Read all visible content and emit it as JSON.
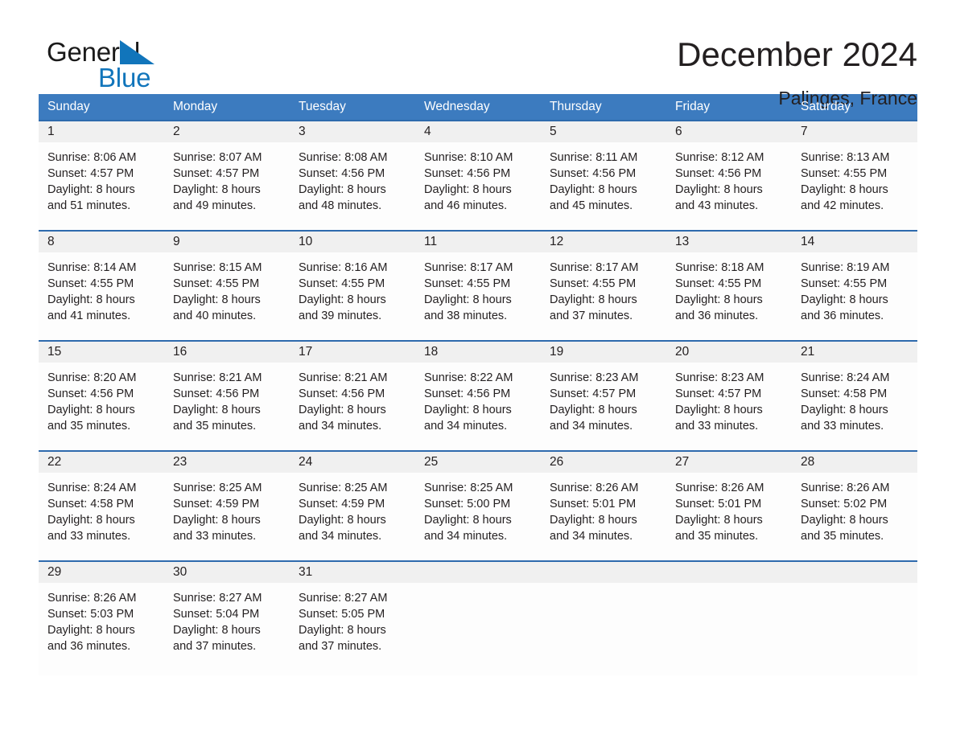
{
  "brand": {
    "word1": "General",
    "word2": "Blue",
    "triangle_color": "#1175bb"
  },
  "header": {
    "title": "December 2024",
    "subtitle": "Palinges, France",
    "accent_color": "#3c7bbf",
    "separator_color": "#2e6aad",
    "date_band_color": "#f0f0f0"
  },
  "weekdays": [
    "Sunday",
    "Monday",
    "Tuesday",
    "Wednesday",
    "Thursday",
    "Friday",
    "Saturday"
  ],
  "weeks": [
    {
      "days": [
        {
          "date": "1",
          "sunrise": "Sunrise: 8:06 AM",
          "sunset": "Sunset: 4:57 PM",
          "daylight_line1": "Daylight: 8 hours",
          "daylight_line2": "and 51 minutes."
        },
        {
          "date": "2",
          "sunrise": "Sunrise: 8:07 AM",
          "sunset": "Sunset: 4:57 PM",
          "daylight_line1": "Daylight: 8 hours",
          "daylight_line2": "and 49 minutes."
        },
        {
          "date": "3",
          "sunrise": "Sunrise: 8:08 AM",
          "sunset": "Sunset: 4:56 PM",
          "daylight_line1": "Daylight: 8 hours",
          "daylight_line2": "and 48 minutes."
        },
        {
          "date": "4",
          "sunrise": "Sunrise: 8:10 AM",
          "sunset": "Sunset: 4:56 PM",
          "daylight_line1": "Daylight: 8 hours",
          "daylight_line2": "and 46 minutes."
        },
        {
          "date": "5",
          "sunrise": "Sunrise: 8:11 AM",
          "sunset": "Sunset: 4:56 PM",
          "daylight_line1": "Daylight: 8 hours",
          "daylight_line2": "and 45 minutes."
        },
        {
          "date": "6",
          "sunrise": "Sunrise: 8:12 AM",
          "sunset": "Sunset: 4:56 PM",
          "daylight_line1": "Daylight: 8 hours",
          "daylight_line2": "and 43 minutes."
        },
        {
          "date": "7",
          "sunrise": "Sunrise: 8:13 AM",
          "sunset": "Sunset: 4:55 PM",
          "daylight_line1": "Daylight: 8 hours",
          "daylight_line2": "and 42 minutes."
        }
      ]
    },
    {
      "days": [
        {
          "date": "8",
          "sunrise": "Sunrise: 8:14 AM",
          "sunset": "Sunset: 4:55 PM",
          "daylight_line1": "Daylight: 8 hours",
          "daylight_line2": "and 41 minutes."
        },
        {
          "date": "9",
          "sunrise": "Sunrise: 8:15 AM",
          "sunset": "Sunset: 4:55 PM",
          "daylight_line1": "Daylight: 8 hours",
          "daylight_line2": "and 40 minutes."
        },
        {
          "date": "10",
          "sunrise": "Sunrise: 8:16 AM",
          "sunset": "Sunset: 4:55 PM",
          "daylight_line1": "Daylight: 8 hours",
          "daylight_line2": "and 39 minutes."
        },
        {
          "date": "11",
          "sunrise": "Sunrise: 8:17 AM",
          "sunset": "Sunset: 4:55 PM",
          "daylight_line1": "Daylight: 8 hours",
          "daylight_line2": "and 38 minutes."
        },
        {
          "date": "12",
          "sunrise": "Sunrise: 8:17 AM",
          "sunset": "Sunset: 4:55 PM",
          "daylight_line1": "Daylight: 8 hours",
          "daylight_line2": "and 37 minutes."
        },
        {
          "date": "13",
          "sunrise": "Sunrise: 8:18 AM",
          "sunset": "Sunset: 4:55 PM",
          "daylight_line1": "Daylight: 8 hours",
          "daylight_line2": "and 36 minutes."
        },
        {
          "date": "14",
          "sunrise": "Sunrise: 8:19 AM",
          "sunset": "Sunset: 4:55 PM",
          "daylight_line1": "Daylight: 8 hours",
          "daylight_line2": "and 36 minutes."
        }
      ]
    },
    {
      "days": [
        {
          "date": "15",
          "sunrise": "Sunrise: 8:20 AM",
          "sunset": "Sunset: 4:56 PM",
          "daylight_line1": "Daylight: 8 hours",
          "daylight_line2": "and 35 minutes."
        },
        {
          "date": "16",
          "sunrise": "Sunrise: 8:21 AM",
          "sunset": "Sunset: 4:56 PM",
          "daylight_line1": "Daylight: 8 hours",
          "daylight_line2": "and 35 minutes."
        },
        {
          "date": "17",
          "sunrise": "Sunrise: 8:21 AM",
          "sunset": "Sunset: 4:56 PM",
          "daylight_line1": "Daylight: 8 hours",
          "daylight_line2": "and 34 minutes."
        },
        {
          "date": "18",
          "sunrise": "Sunrise: 8:22 AM",
          "sunset": "Sunset: 4:56 PM",
          "daylight_line1": "Daylight: 8 hours",
          "daylight_line2": "and 34 minutes."
        },
        {
          "date": "19",
          "sunrise": "Sunrise: 8:23 AM",
          "sunset": "Sunset: 4:57 PM",
          "daylight_line1": "Daylight: 8 hours",
          "daylight_line2": "and 34 minutes."
        },
        {
          "date": "20",
          "sunrise": "Sunrise: 8:23 AM",
          "sunset": "Sunset: 4:57 PM",
          "daylight_line1": "Daylight: 8 hours",
          "daylight_line2": "and 33 minutes."
        },
        {
          "date": "21",
          "sunrise": "Sunrise: 8:24 AM",
          "sunset": "Sunset: 4:58 PM",
          "daylight_line1": "Daylight: 8 hours",
          "daylight_line2": "and 33 minutes."
        }
      ]
    },
    {
      "days": [
        {
          "date": "22",
          "sunrise": "Sunrise: 8:24 AM",
          "sunset": "Sunset: 4:58 PM",
          "daylight_line1": "Daylight: 8 hours",
          "daylight_line2": "and 33 minutes."
        },
        {
          "date": "23",
          "sunrise": "Sunrise: 8:25 AM",
          "sunset": "Sunset: 4:59 PM",
          "daylight_line1": "Daylight: 8 hours",
          "daylight_line2": "and 33 minutes."
        },
        {
          "date": "24",
          "sunrise": "Sunrise: 8:25 AM",
          "sunset": "Sunset: 4:59 PM",
          "daylight_line1": "Daylight: 8 hours",
          "daylight_line2": "and 34 minutes."
        },
        {
          "date": "25",
          "sunrise": "Sunrise: 8:25 AM",
          "sunset": "Sunset: 5:00 PM",
          "daylight_line1": "Daylight: 8 hours",
          "daylight_line2": "and 34 minutes."
        },
        {
          "date": "26",
          "sunrise": "Sunrise: 8:26 AM",
          "sunset": "Sunset: 5:01 PM",
          "daylight_line1": "Daylight: 8 hours",
          "daylight_line2": "and 34 minutes."
        },
        {
          "date": "27",
          "sunrise": "Sunrise: 8:26 AM",
          "sunset": "Sunset: 5:01 PM",
          "daylight_line1": "Daylight: 8 hours",
          "daylight_line2": "and 35 minutes."
        },
        {
          "date": "28",
          "sunrise": "Sunrise: 8:26 AM",
          "sunset": "Sunset: 5:02 PM",
          "daylight_line1": "Daylight: 8 hours",
          "daylight_line2": "and 35 minutes."
        }
      ]
    },
    {
      "days": [
        {
          "date": "29",
          "sunrise": "Sunrise: 8:26 AM",
          "sunset": "Sunset: 5:03 PM",
          "daylight_line1": "Daylight: 8 hours",
          "daylight_line2": "and 36 minutes."
        },
        {
          "date": "30",
          "sunrise": "Sunrise: 8:27 AM",
          "sunset": "Sunset: 5:04 PM",
          "daylight_line1": "Daylight: 8 hours",
          "daylight_line2": "and 37 minutes."
        },
        {
          "date": "31",
          "sunrise": "Sunrise: 8:27 AM",
          "sunset": "Sunset: 5:05 PM",
          "daylight_line1": "Daylight: 8 hours",
          "daylight_line2": "and 37 minutes."
        },
        {
          "date": "",
          "sunrise": "",
          "sunset": "",
          "daylight_line1": "",
          "daylight_line2": ""
        },
        {
          "date": "",
          "sunrise": "",
          "sunset": "",
          "daylight_line1": "",
          "daylight_line2": ""
        },
        {
          "date": "",
          "sunrise": "",
          "sunset": "",
          "daylight_line1": "",
          "daylight_line2": ""
        },
        {
          "date": "",
          "sunrise": "",
          "sunset": "",
          "daylight_line1": "",
          "daylight_line2": ""
        }
      ]
    }
  ]
}
